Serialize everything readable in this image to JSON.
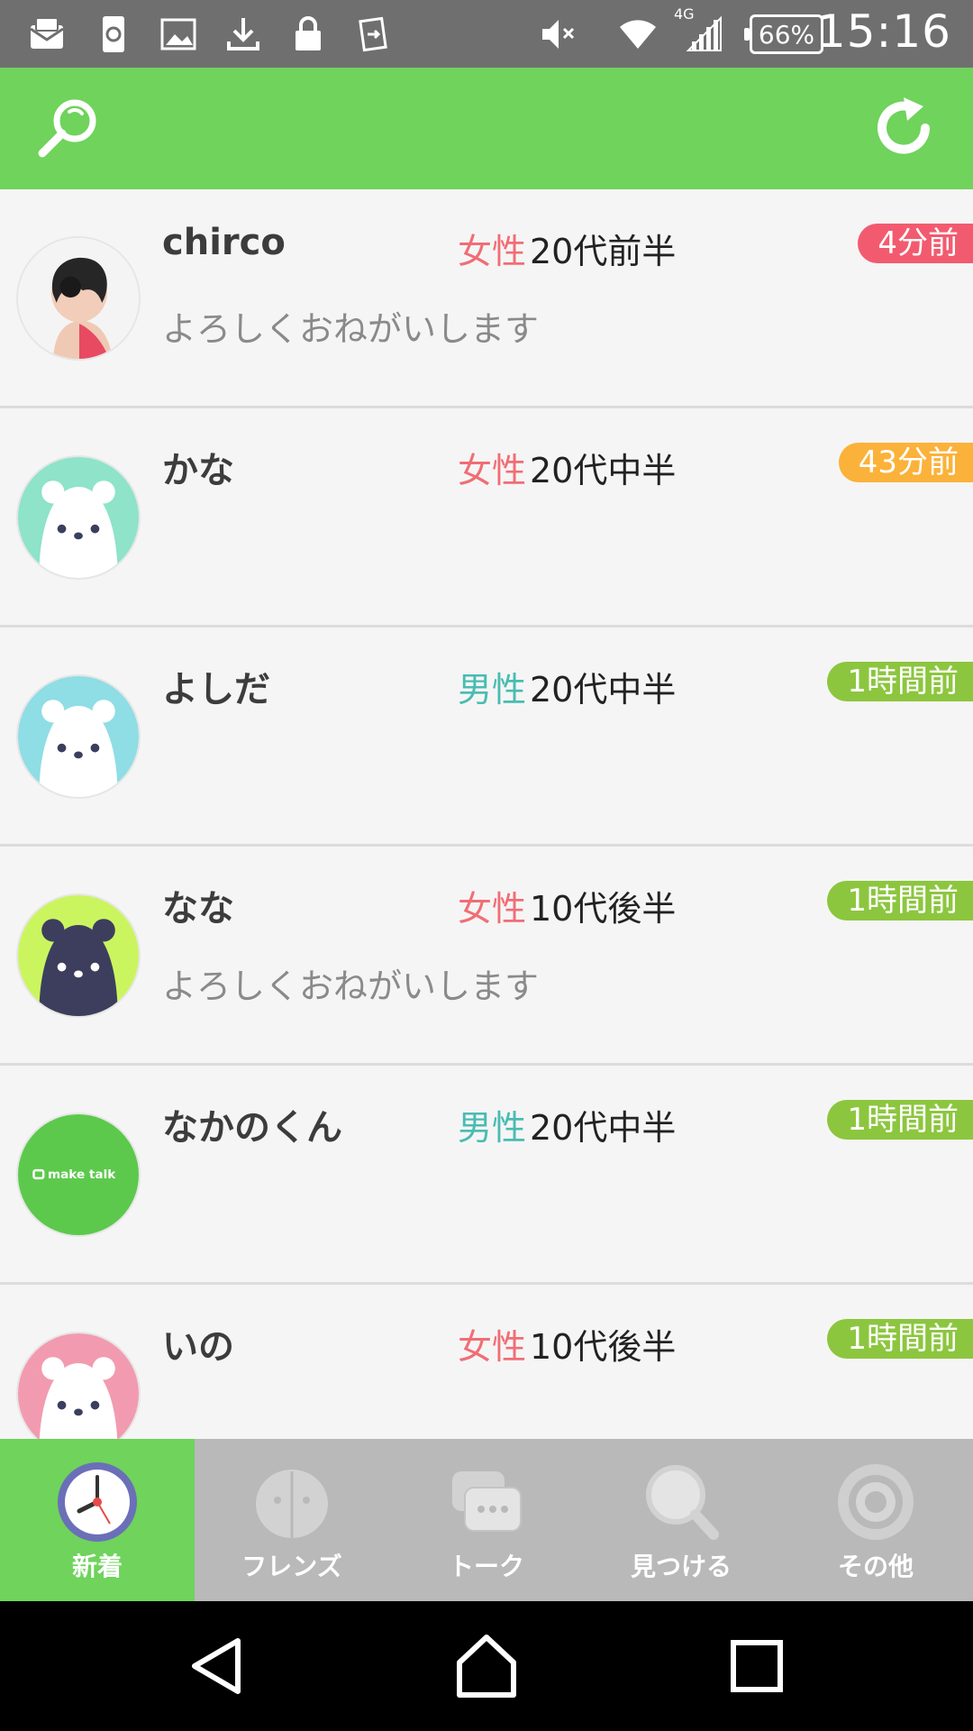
{
  "status_bar": {
    "time": "15:16",
    "battery": "66%",
    "network": "4G",
    "left_icons": [
      "mail-icon",
      "sync-icon",
      "image-icon",
      "download-icon",
      "lock-icon",
      "transfer-icon"
    ],
    "right_icons": [
      "mute-icon",
      "wifi-icon",
      "signal-icon",
      "battery-icon"
    ]
  },
  "header": {
    "left_icon": "search-icon",
    "right_icon": "refresh-icon",
    "background": "#6fd35c"
  },
  "colors": {
    "female": "#f16d75",
    "male": "#49bcb2",
    "badge_red": "#f25b6f",
    "badge_orange": "#fbb23a",
    "badge_green": "#8cc63f"
  },
  "users": [
    {
      "name": "chirco",
      "gender": "女性",
      "gender_key": "f",
      "age": "20代前半",
      "time": "4分前",
      "badge_color": "#f25b6f",
      "message": "よろしくおねがいします",
      "avatar": "photo"
    },
    {
      "name": "かな",
      "gender": "女性",
      "gender_key": "f",
      "age": "20代中半",
      "time": "43分前",
      "badge_color": "#fbb23a",
      "message": "",
      "avatar": "bear-white-mint"
    },
    {
      "name": "よしだ",
      "gender": "男性",
      "gender_key": "m",
      "age": "20代中半",
      "time": "1時間前",
      "badge_color": "#8cc63f",
      "message": "",
      "avatar": "bear-white-cyan"
    },
    {
      "name": "なな",
      "gender": "女性",
      "gender_key": "f",
      "age": "10代後半",
      "time": "1時間前",
      "badge_color": "#8cc63f",
      "message": "よろしくおねがいします",
      "avatar": "bear-dark-lime"
    },
    {
      "name": "なかのくん",
      "gender": "男性",
      "gender_key": "m",
      "age": "20代中半",
      "time": "1時間前",
      "badge_color": "#8cc63f",
      "message": "",
      "avatar": "maketalk-logo",
      "avatar_text": "make talk"
    },
    {
      "name": "いの",
      "gender": "女性",
      "gender_key": "f",
      "age": "10代後半",
      "time": "1時間前",
      "badge_color": "#8cc63f",
      "message": "",
      "avatar": "bear-white-pink"
    }
  ],
  "tabs": [
    {
      "label": "新着",
      "icon": "clock-icon",
      "active": true
    },
    {
      "label": "フレンズ",
      "icon": "friends-icon",
      "active": false
    },
    {
      "label": "トーク",
      "icon": "talk-icon",
      "active": false
    },
    {
      "label": "見つける",
      "icon": "find-icon",
      "active": false
    },
    {
      "label": "その他",
      "icon": "settings-icon",
      "active": false
    }
  ],
  "nav": {
    "icons": [
      "back-icon",
      "home-icon",
      "recents-icon"
    ]
  }
}
